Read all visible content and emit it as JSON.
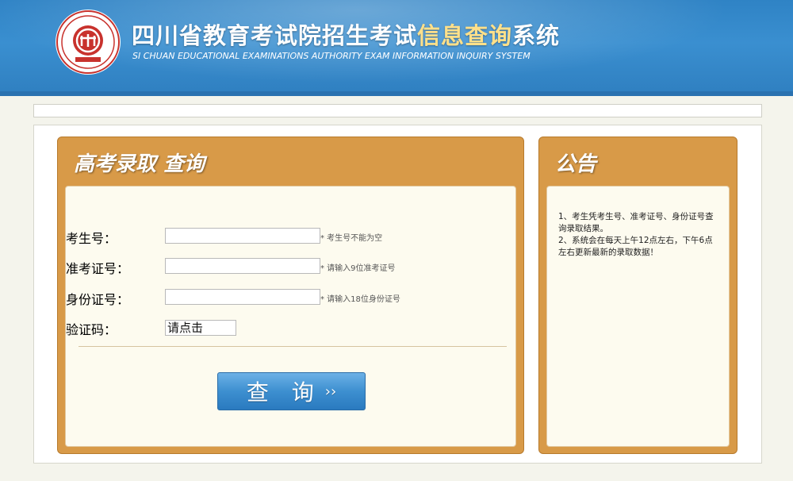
{
  "header": {
    "title_cn_part1": "四川省教育考试院招生考试",
    "title_cn_part2": "信息查询",
    "title_cn_part3": "系统",
    "title_en": "SI CHUAN EDUCATIONAL EXAMINATIONS AUTHORITY EXAM INFORMATION INQUIRY SYSTEM",
    "logo_icon": "education-authority-seal-icon"
  },
  "query_panel": {
    "title": "高考录取 查询",
    "fields": {
      "exam_number": {
        "label": "考生号：",
        "value": "",
        "hint": "* 考生号不能为空"
      },
      "admission_ticket": {
        "label": "准考证号：",
        "value": "",
        "hint": "* 请输入9位准考证号"
      },
      "id_number": {
        "label": "身份证号：",
        "value": "",
        "hint": "* 请输入18位身份证号"
      },
      "captcha": {
        "label": "验证码：",
        "value": "请点击"
      }
    },
    "submit_label": "查 询",
    "submit_icon": "double-chevron-right-icon"
  },
  "notice_panel": {
    "title": "公告",
    "items": [
      "1、考生凭考生号、准考证号、身份证号查询录取结果。",
      "2、系统会在每天上午12点左右，下午6点左右更新最新的录取数据！"
    ]
  },
  "colors": {
    "header_blue": "#3a8fd0",
    "panel_orange": "#d89a48",
    "panel_body": "#fdfbef",
    "button_blue": "#3d8fd0",
    "highlight_yellow": "#ffe08a"
  }
}
